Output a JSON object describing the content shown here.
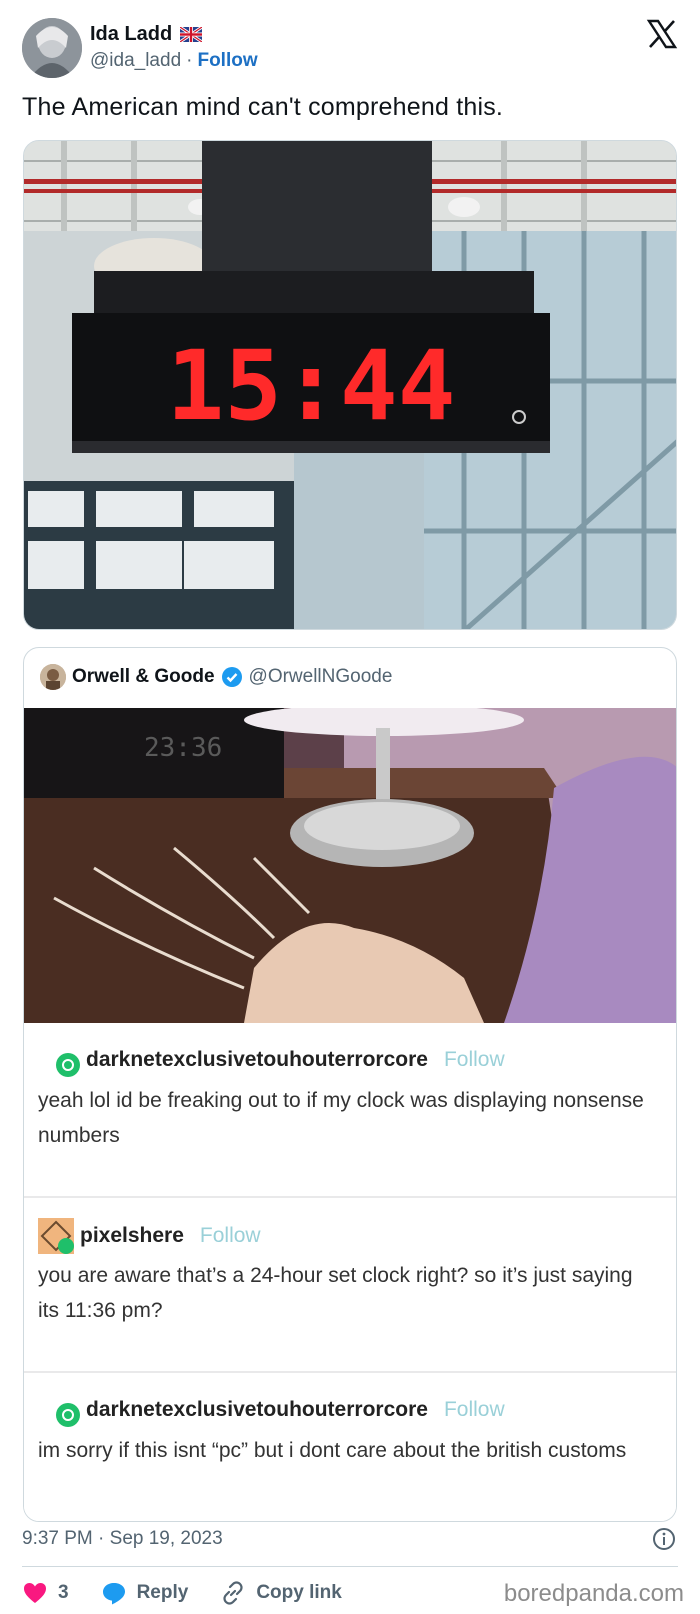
{
  "author": {
    "name": "Ida Ladd",
    "handle": "@ida_ladd",
    "separator": "·",
    "follow_label": "Follow",
    "flag_icon": "uk-flag-icon"
  },
  "platform_icon": "x-logo-icon",
  "tweet_text": "The American mind can't comprehend this.",
  "media_clock_display": "15:44",
  "quoted": {
    "name": "Orwell & Goode",
    "handle": "@OrwellNGoode",
    "verified": true,
    "image_clock_display": "23:36",
    "tumblr_posts": [
      {
        "user": "darknetexclusivetouhouterrorcore",
        "follow_label": "Follow",
        "text": "yeah lol id be freaking out to if my clock was displaying nonsense numbers"
      },
      {
        "user": "pixelshere",
        "follow_label": "Follow",
        "text": "you are aware that’s a 24-hour set clock right? so it’s just saying its 11:36 pm?"
      },
      {
        "user": "darknetexclusivetouhouterrorcore",
        "follow_label": "Follow",
        "text": "im sorry if this isnt “pc” but i dont care about the british customs"
      }
    ]
  },
  "timestamp": "9:37 PM · Sep 19, 2023",
  "actions": {
    "like_count": "3",
    "reply_label": "Reply",
    "copy_label": "Copy link"
  },
  "watermark": "boredpanda.com",
  "colors": {
    "follow_blue": "#1d70c4",
    "like_pink": "#f91880",
    "reply_blue": "#1d9bf0",
    "tumblr_green": "#1fbf6a"
  }
}
